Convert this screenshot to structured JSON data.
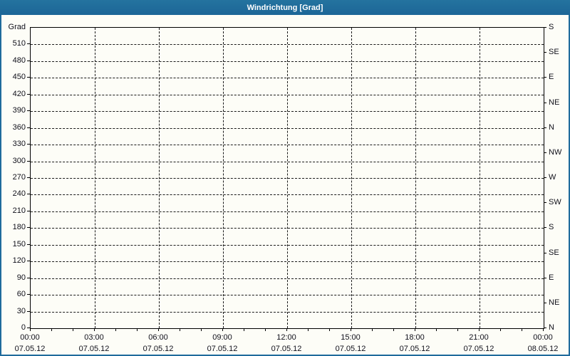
{
  "window": {
    "title": "Windrichtung [Grad]"
  },
  "colors": {
    "titlebar": "#1f6b9c",
    "border": "#1f6b9c",
    "title_text": "#ffffff",
    "background": "#fdfdf7",
    "grid": "#1a1a1a",
    "axis": "#000000",
    "label_text": "#10101a"
  },
  "chart_data": {
    "type": "line",
    "title": "Windrichtung [Grad]",
    "series": [],
    "note": "empty plot - no data trace visible",
    "grid": "dashed",
    "y_axis_left": {
      "unit_label": "Grad",
      "min": 0,
      "max": 540,
      "tick_step": 30,
      "tick_labels": [
        "510",
        "480",
        "450",
        "420",
        "390",
        "360",
        "330",
        "300",
        "270",
        "240",
        "210",
        "180",
        "150",
        "120",
        "90",
        "60",
        "30",
        "0"
      ]
    },
    "y_axis_right": {
      "min": 0,
      "max": 540,
      "tick_step": 45,
      "tick_labels_top_to_bottom": [
        "S",
        "SE",
        "E",
        "NE",
        "N",
        "NW",
        "W",
        "SW",
        "S",
        "SE",
        "E",
        "NE",
        "N"
      ]
    },
    "x_axis": {
      "minor_tick_hours": 1,
      "major_tick_hours": 3,
      "range_hours": 24,
      "ticks": [
        {
          "time": "00:00",
          "date": "07.05.12"
        },
        {
          "time": "03:00",
          "date": "07.05.12"
        },
        {
          "time": "06:00",
          "date": "07.05.12"
        },
        {
          "time": "09:00",
          "date": "07.05.12"
        },
        {
          "time": "12:00",
          "date": "07.05.12"
        },
        {
          "time": "15:00",
          "date": "07.05.12"
        },
        {
          "time": "18:00",
          "date": "07.05.12"
        },
        {
          "time": "21:00",
          "date": "07.05.12"
        },
        {
          "time": "00:00",
          "date": "08.05.12"
        }
      ]
    }
  }
}
